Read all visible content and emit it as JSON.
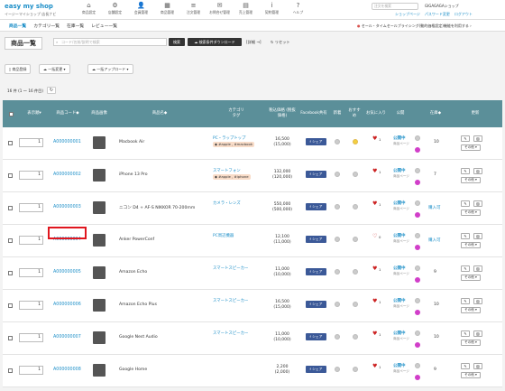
{
  "header": {
    "logo": "easy my shop",
    "logo_sub": "イージーマイショップ 店長ナビ",
    "nav": [
      {
        "icon": "home-icon",
        "glyph": "⌂",
        "label": "商品設定"
      },
      {
        "icon": "settings-icon",
        "glyph": "⚙",
        "label": "店舗設定"
      },
      {
        "icon": "members-icon",
        "glyph": "👤",
        "label": "会員管理"
      },
      {
        "icon": "products-icon",
        "glyph": "▦",
        "label": "商品管理"
      },
      {
        "icon": "orders-icon",
        "glyph": "≡",
        "label": "注文管理"
      },
      {
        "icon": "inquiry-icon",
        "glyph": "✉",
        "label": "お問合せ管理"
      },
      {
        "icon": "sales-icon",
        "glyph": "▤",
        "label": "売上管理"
      },
      {
        "icon": "info-icon",
        "glyph": "i",
        "label": "契約管理"
      },
      {
        "icon": "help-icon",
        "glyph": "?",
        "label": "ヘルプ"
      }
    ],
    "search_placeholder": "注文を検索",
    "shop_name": "GIGAGAGAショップ",
    "links": [
      "ショップページ",
      "パスワード変更",
      "ログアウト"
    ]
  },
  "subnav": {
    "tabs": [
      "商品一覧",
      "カテゴリ一覧",
      "在庫一覧",
      "レビュー一覧"
    ],
    "notice": "セール・タイムセールプライシング(動的価格設定)機能を利用する"
  },
  "toolbar": {
    "title": "商品一覧",
    "search_placeholder": "コード/名前/説明で検索",
    "search_button": "検索",
    "detail_search_button": "検索条件ダウンロード",
    "detail_link": "[詳細 →]",
    "reset_link": "リセット"
  },
  "actions": {
    "new_button": "商品登録",
    "bulk_change": "一括変更",
    "bulk_upload": "一括アップロード"
  },
  "count_text": "16 件 (1 ～ 16 件目)",
  "columns": [
    "表示順",
    "商品コード",
    "商品画像",
    "商品名",
    "カテゴリ",
    "税込価格 (税抜価格)",
    "Facebook共有",
    "新着",
    "おすすめ",
    "お気に入り",
    "公開",
    "在庫",
    "更新"
  ],
  "columns_sub": {
    "cat_tag": "タグ"
  },
  "rows": [
    {
      "qty": "1",
      "code": "A000000001",
      "name": "Macbook Air",
      "category": "PC・ラップトップ",
      "tags": "#apple , #macbook",
      "price": "16,500",
      "price_ex": "(15,000)",
      "fav_count": "1",
      "new": "on",
      "pub": "公開中",
      "stock": "10",
      "stock_buy": ""
    },
    {
      "qty": "1",
      "code": "A000000002",
      "name": "iPhone 13 Pro",
      "category": "スマートフォン",
      "tags": "#apple , #iphone",
      "price": "132,000",
      "price_ex": "(120,000)",
      "fav_count": "1",
      "new": "off",
      "pub": "公開中",
      "stock": "7",
      "stock_buy": ""
    },
    {
      "qty": "1",
      "code": "A000000003",
      "name": "ニコン D4 + AF-S NIKKOR 70-200mm",
      "category": "カメラ・レンズ",
      "tags": "",
      "price": "550,000",
      "price_ex": "(500,000)",
      "fav_count": "1",
      "new": "off",
      "pub": "公開中",
      "stock": "",
      "stock_buy": "購入可"
    },
    {
      "qty": "1",
      "code": "A000000004",
      "name": "Anker PowerConf",
      "category": "PC周辺機器",
      "tags": "",
      "price": "12,100",
      "price_ex": "(11,000)",
      "fav_count": "0",
      "new": "off",
      "pub": "公開中",
      "stock": "",
      "stock_buy": "購入可"
    },
    {
      "qty": "1",
      "code": "A000000005",
      "name": "Amazon Echo",
      "category": "スマートスピーカー",
      "tags": "",
      "price": "11,000",
      "price_ex": "(10,000)",
      "fav_count": "1",
      "new": "off",
      "pub": "公開中",
      "stock": "9",
      "stock_buy": ""
    },
    {
      "qty": "1",
      "code": "A000000006",
      "name": "Amazon Echo Plus",
      "category": "スマートスピーカー",
      "tags": "",
      "price": "16,500",
      "price_ex": "(15,000)",
      "fav_count": "1",
      "new": "off",
      "pub": "公開中",
      "stock": "10",
      "stock_buy": ""
    },
    {
      "qty": "1",
      "code": "A000000007",
      "name": "Google Nest Audio",
      "category": "スマートスピーカー",
      "tags": "",
      "price": "11,000",
      "price_ex": "(10,000)",
      "fav_count": "1",
      "new": "off",
      "pub": "公開中",
      "stock": "10",
      "stock_buy": ""
    },
    {
      "qty": "1",
      "code": "A000000008",
      "name": "Google Home",
      "category": "",
      "tags": "",
      "price": "2,200",
      "price_ex": "(2,000)",
      "fav_count": "1",
      "new": "off",
      "pub": "公開中",
      "stock": "9",
      "stock_buy": ""
    }
  ],
  "row_labels": {
    "fb": "f シェア",
    "pub_sub": "商品ページ",
    "other": "その他"
  },
  "colors": {
    "header_bg": "#5b8f99",
    "link": "#1d8fc8",
    "highlight": "#e0161e"
  }
}
